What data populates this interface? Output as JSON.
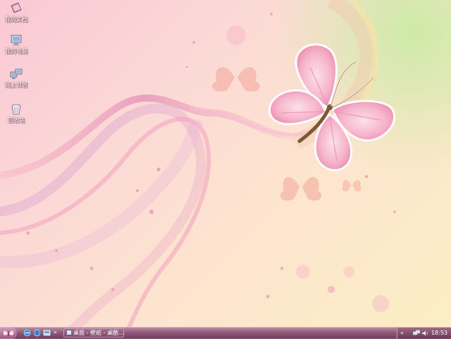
{
  "desktop": {
    "icons": [
      {
        "label": "我的文档",
        "icon": "my-documents-icon"
      },
      {
        "label": "我的电脑",
        "icon": "my-computer-icon"
      },
      {
        "label": "网上邻居",
        "icon": "network-places-icon"
      },
      {
        "label": "回收站",
        "icon": "recycle-bin-icon"
      }
    ]
  },
  "taskbar": {
    "quick_launch_more": "»",
    "task_item_label": "桌面 - 壁纸 - 桌酷...",
    "tray_expand": "«",
    "clock": "18:53"
  },
  "colors": {
    "taskbar": "#8e5a78",
    "butterfly_pink": "#f2a9c4",
    "wallpaper_peach": "#fde4cf"
  }
}
